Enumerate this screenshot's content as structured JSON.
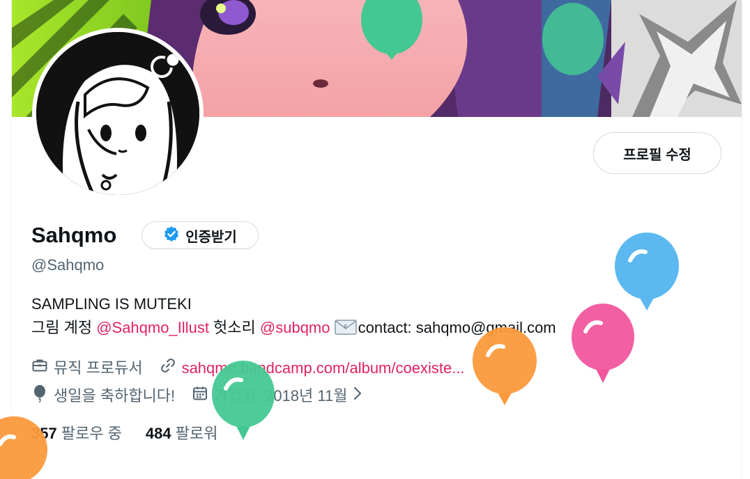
{
  "profile": {
    "display_name": "Sahqmo",
    "verify_label": "인증받기",
    "handle": "@Sahqmo",
    "edit_label": "프로필 수정"
  },
  "bio": {
    "line1": "SAMPLING IS MUTEKI",
    "line2_prefix": "그림 계정 ",
    "mention1": "@Sahqmo_Illust",
    "line2_mid": " 헛소리 ",
    "mention2": "@subqmo",
    "line2_contact": "contact: sahqmo@gmail.com"
  },
  "meta": {
    "category": "뮤직 프로듀서",
    "link": "sahqmo.bandcamp.com/album/coexiste...",
    "birthday": "생일을 축하합니다!",
    "joined": "가입일: 2018년 11월"
  },
  "stats": {
    "following_count": "357",
    "following_label": "팔로우 중",
    "followers_count": "484",
    "followers_label": "팔로워"
  },
  "icons": {
    "briefcase": "briefcase-icon",
    "link": "link-icon",
    "balloon": "balloon-icon",
    "calendar": "calendar-icon",
    "verified": "verified-badge-icon",
    "envelope": "envelope-icon",
    "chevron": "chevron-right-icon"
  },
  "colors": {
    "accent": "#e0245e",
    "verified": "#1d9bf0",
    "muted_text": "#536471",
    "balloon_blue": "#5bb8f0",
    "balloon_pink": "#f2569e",
    "balloon_orange": "#fb9a3d",
    "balloon_green": "#44c893"
  }
}
